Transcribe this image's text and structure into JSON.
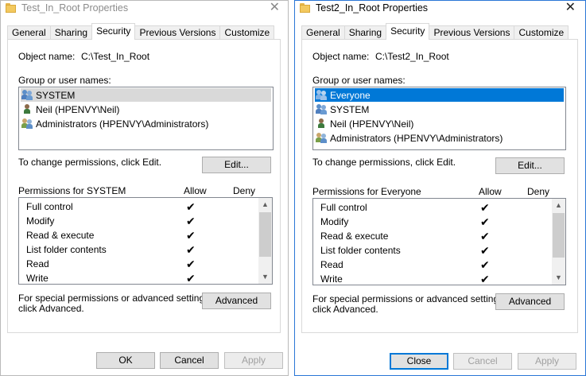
{
  "windows": [
    {
      "title": "Test_In_Root Properties",
      "close_glyph": "✕",
      "tabs": [
        "General",
        "Sharing",
        "Security",
        "Previous Versions",
        "Customize"
      ],
      "active_tab": "Security",
      "object_name_label": "Object name:",
      "object_name_value": "C:\\Test_In_Root",
      "group_label": "Group or user names:",
      "users": [
        {
          "name": "SYSTEM",
          "icon": "group-users-icon",
          "selected": "gray"
        },
        {
          "name": "Neil (HPENVY\\Neil)",
          "icon": "single-user-icon",
          "selected": "none"
        },
        {
          "name": "Administrators (HPENVY\\Administrators)",
          "icon": "group-users-icon",
          "selected": "none"
        }
      ],
      "change_text": "To change permissions, click Edit.",
      "edit_label": "Edit...",
      "perm_header": "Permissions for SYSTEM",
      "allow_label": "Allow",
      "deny_label": "Deny",
      "permissions": [
        {
          "name": "Full control",
          "allow": "✔"
        },
        {
          "name": "Modify",
          "allow": "✔"
        },
        {
          "name": "Read & execute",
          "allow": "✔"
        },
        {
          "name": "List folder contents",
          "allow": "✔"
        },
        {
          "name": "Read",
          "allow": "✔"
        },
        {
          "name": "Write",
          "allow": "✔"
        }
      ],
      "special_text_1": "For special permissions or advanced settings,",
      "special_text_2": "click Advanced.",
      "advanced_label": "Advanced",
      "buttons": {
        "primary": "OK",
        "cancel": "Cancel",
        "apply": "Apply"
      }
    },
    {
      "title": "Test2_In_Root Properties",
      "close_glyph": "✕",
      "tabs": [
        "General",
        "Sharing",
        "Security",
        "Previous Versions",
        "Customize"
      ],
      "active_tab": "Security",
      "object_name_label": "Object name:",
      "object_name_value": "C:\\Test2_In_Root",
      "group_label": "Group or user names:",
      "users": [
        {
          "name": "Everyone",
          "icon": "group-users-icon",
          "selected": "blue"
        },
        {
          "name": "SYSTEM",
          "icon": "group-users-icon",
          "selected": "none"
        },
        {
          "name": "Neil (HPENVY\\Neil)",
          "icon": "single-user-icon",
          "selected": "none"
        },
        {
          "name": "Administrators (HPENVY\\Administrators)",
          "icon": "group-users-icon",
          "selected": "none"
        }
      ],
      "change_text": "To change permissions, click Edit.",
      "edit_label": "Edit...",
      "perm_header": "Permissions for Everyone",
      "allow_label": "Allow",
      "deny_label": "Deny",
      "permissions": [
        {
          "name": "Full control",
          "allow": "✔"
        },
        {
          "name": "Modify",
          "allow": "✔"
        },
        {
          "name": "Read & execute",
          "allow": "✔"
        },
        {
          "name": "List folder contents",
          "allow": "✔"
        },
        {
          "name": "Read",
          "allow": "✔"
        },
        {
          "name": "Write",
          "allow": "✔"
        }
      ],
      "special_text_1": "For special permissions or advanced settings,",
      "special_text_2": "click Advanced.",
      "advanced_label": "Advanced",
      "buttons": {
        "primary": "Close",
        "cancel": "Cancel",
        "apply": "Apply"
      }
    }
  ],
  "scroll_up_glyph": "▲",
  "scroll_down_glyph": "▼",
  "colors": {
    "selection_blue": "#0078d7",
    "selection_gray": "#d9d9d9",
    "focus_border": "#2b77d6"
  }
}
